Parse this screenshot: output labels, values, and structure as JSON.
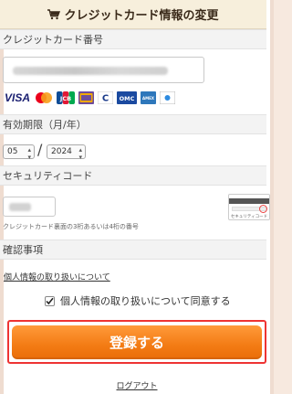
{
  "header": {
    "title": "クレジットカード情報の変更",
    "icon": "cart-icon"
  },
  "card_number": {
    "label": "クレジットカード番号",
    "value": "",
    "brands": [
      {
        "name": "visa",
        "label": "VISA"
      },
      {
        "name": "mastercard",
        "label": ""
      },
      {
        "name": "jcb",
        "label": "JCB"
      },
      {
        "name": "diners",
        "label": "Diners"
      },
      {
        "name": "cbs",
        "label": "C"
      },
      {
        "name": "omc",
        "label": "OMC"
      },
      {
        "name": "amex",
        "label": "AMEX"
      },
      {
        "name": "other",
        "label": ""
      }
    ]
  },
  "expiry": {
    "label": "有効期限（月/年）",
    "month": "05",
    "year": "2024",
    "separator": "/"
  },
  "security": {
    "label": "セキュリティコード",
    "value": "",
    "note": "クレジットカード裏面の3桁あるいは4桁の番号",
    "image_label": "セキュリティコード"
  },
  "confirm": {
    "label": "確認事項",
    "privacy_link": "個人情報の取り扱いについて",
    "agree_label": "個人情報の取り扱いについて同意する",
    "agree_checked": true
  },
  "submit_label": "登録する",
  "logout_label": "ログアウト",
  "colors": {
    "accent": "#f37b14",
    "highlight_border": "#ee3333",
    "header_bg": "#f7efdc"
  }
}
